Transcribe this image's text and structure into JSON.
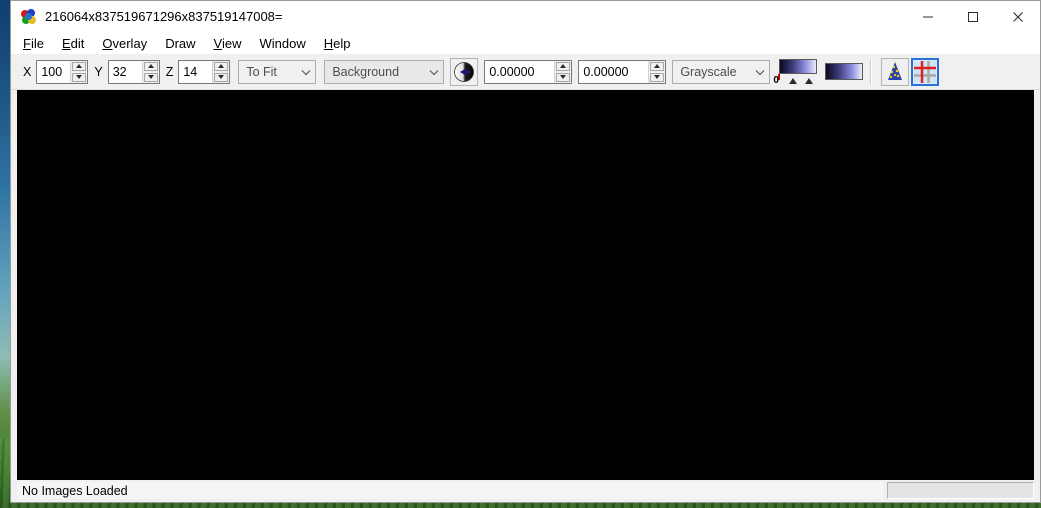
{
  "window": {
    "title": "216064x837519671296x837519147008=",
    "app_icon": "brain-icon",
    "controls": {
      "minimize": "minimize-icon",
      "maximize": "maximize-icon",
      "close": "close-icon"
    }
  },
  "menubar": {
    "items": [
      {
        "label": "File",
        "acc": "F",
        "rest": "ile"
      },
      {
        "label": "Edit",
        "acc": "E",
        "rest": "dit"
      },
      {
        "label": "Overlay",
        "acc": "O",
        "rest": "verlay"
      },
      {
        "label": "Draw",
        "acc": "",
        "rest": "Draw"
      },
      {
        "label": "View",
        "acc": "V",
        "rest": "iew"
      },
      {
        "label": "Window",
        "acc": "",
        "rest": "Window"
      },
      {
        "label": "Help",
        "acc": "H",
        "rest": "elp"
      }
    ]
  },
  "toolbar": {
    "x_label": "X",
    "x_value": "100",
    "y_label": "Y",
    "y_value": "32",
    "z_label": "Z",
    "z_value": "14",
    "zoom_select": "To Fit",
    "layer_select": "Background",
    "rotate_button": "sphere-arrow-icon",
    "min_value": "0.00000",
    "max_value": "0.00000",
    "colormap_select": "Grayscale",
    "gradient_zero_label": "0",
    "hat_button": "party-hat-icon",
    "crosshair_button": "crosshair-grid-icon"
  },
  "statusbar": {
    "message": "No Images Loaded",
    "right_panel": ""
  },
  "canvas": {
    "background_color": "#000000",
    "content": ""
  },
  "colors": {
    "window_bg": "#f0f0f0",
    "titlebar_bg": "#ffffff",
    "canvas": "#000000",
    "accent": "#2c6fd6"
  }
}
